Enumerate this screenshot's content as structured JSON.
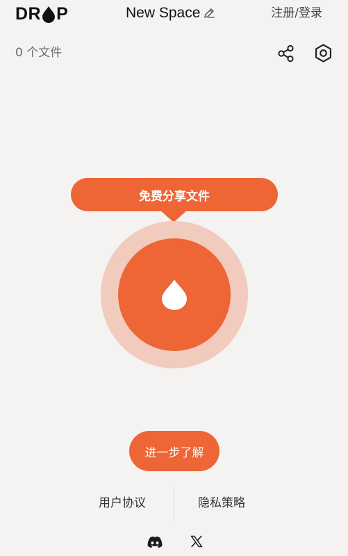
{
  "header": {
    "logo": {
      "left": "DR",
      "right": "P"
    },
    "space_name": "New Space",
    "login_label": "注册/登录"
  },
  "toolbar": {
    "file_count": "0 个文件"
  },
  "hero": {
    "tooltip": "免费分享文件"
  },
  "actions": {
    "learn_more": "进一步了解"
  },
  "footer": {
    "terms": "用户协议",
    "privacy": "隐私策略",
    "social": [
      "discord-icon",
      "x-icon"
    ]
  },
  "colors": {
    "accent": "#ee6536",
    "accent_light": "#f1cbbd",
    "background": "#f4f3f1",
    "text_dark": "#111111",
    "text_muted": "#6b6b6b"
  }
}
